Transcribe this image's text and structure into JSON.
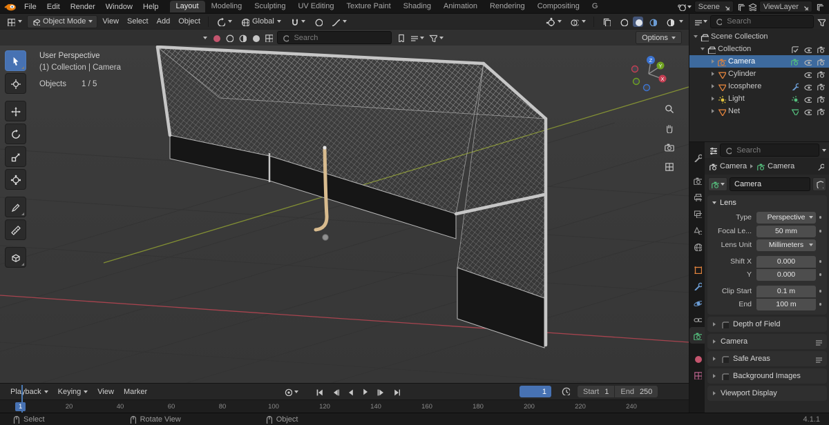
{
  "topbar": {
    "menus": [
      "File",
      "Edit",
      "Render",
      "Window",
      "Help"
    ],
    "workspaces": [
      "Layout",
      "Modeling",
      "Sculpting",
      "UV Editing",
      "Texture Paint",
      "Shading",
      "Animation",
      "Rendering",
      "Compositing",
      "Geomet"
    ],
    "active_workspace": "Layout",
    "scene_selector": {
      "label": "Scene"
    },
    "viewlayer_selector": {
      "label": "ViewLayer"
    }
  },
  "viewport_header": {
    "mode": "Object Mode",
    "menus": [
      "View",
      "Select",
      "Add",
      "Object"
    ],
    "orientation": "Global"
  },
  "viewport_toolbar": {
    "search_placeholder": "Search",
    "options_label": "Options"
  },
  "viewport": {
    "overlay_line1": "User Perspective",
    "overlay_line2": "(1) Collection | Camera",
    "stats_label": "Objects",
    "stats_value": "1 / 5"
  },
  "outliner": {
    "search_placeholder": "Search",
    "scene_collection": "Scene Collection",
    "collection": "Collection",
    "items": [
      {
        "name": "Camera",
        "selected": true
      },
      {
        "name": "Cylinder",
        "selected": false
      },
      {
        "name": "Icosphere",
        "selected": false
      },
      {
        "name": "Light",
        "selected": false
      },
      {
        "name": "Net",
        "selected": false
      }
    ]
  },
  "properties": {
    "search_placeholder": "Search",
    "breadcrumb": {
      "level1": "Camera",
      "level2": "Camera"
    },
    "name_value": "Camera",
    "lens": {
      "title": "Lens",
      "type_label": "Type",
      "type_value": "Perspective",
      "focal_label": "Focal Le...",
      "focal_value": "50 mm",
      "unit_label": "Lens Unit",
      "unit_value": "Millimeters",
      "shift_x_label": "Shift X",
      "shift_x_value": "0.000",
      "shift_y_label": "Y",
      "shift_y_value": "0.000",
      "clip_start_label": "Clip Start",
      "clip_start_value": "0.1 m",
      "clip_end_label": "End",
      "clip_end_value": "100 m"
    },
    "sections": [
      "Depth of Field",
      "Camera",
      "Safe Areas",
      "Background Images",
      "Viewport Display"
    ]
  },
  "timeline": {
    "menus": [
      "Playback",
      "Keying",
      "View",
      "Marker"
    ],
    "frames": [
      "20",
      "40",
      "60",
      "80",
      "100",
      "120",
      "140",
      "160",
      "180",
      "200",
      "220",
      "240"
    ],
    "current_frame": "1",
    "playhead_frame": "1",
    "start_label": "Start",
    "start_value": "1",
    "end_label": "End",
    "end_value": "250"
  },
  "statusbar": {
    "items": [
      "Select",
      "Rotate View",
      "Object"
    ],
    "version": "4.1.1"
  },
  "colors": {
    "accent": "#4772b3",
    "selection_row": "#3d6a9e",
    "axis_x_red": "#a8444f",
    "axis_y_green": "#8f9e33",
    "object_orange": "#e0823c",
    "mesh_data_green": "#55c07e",
    "light_yellow": "#e2c43c"
  }
}
